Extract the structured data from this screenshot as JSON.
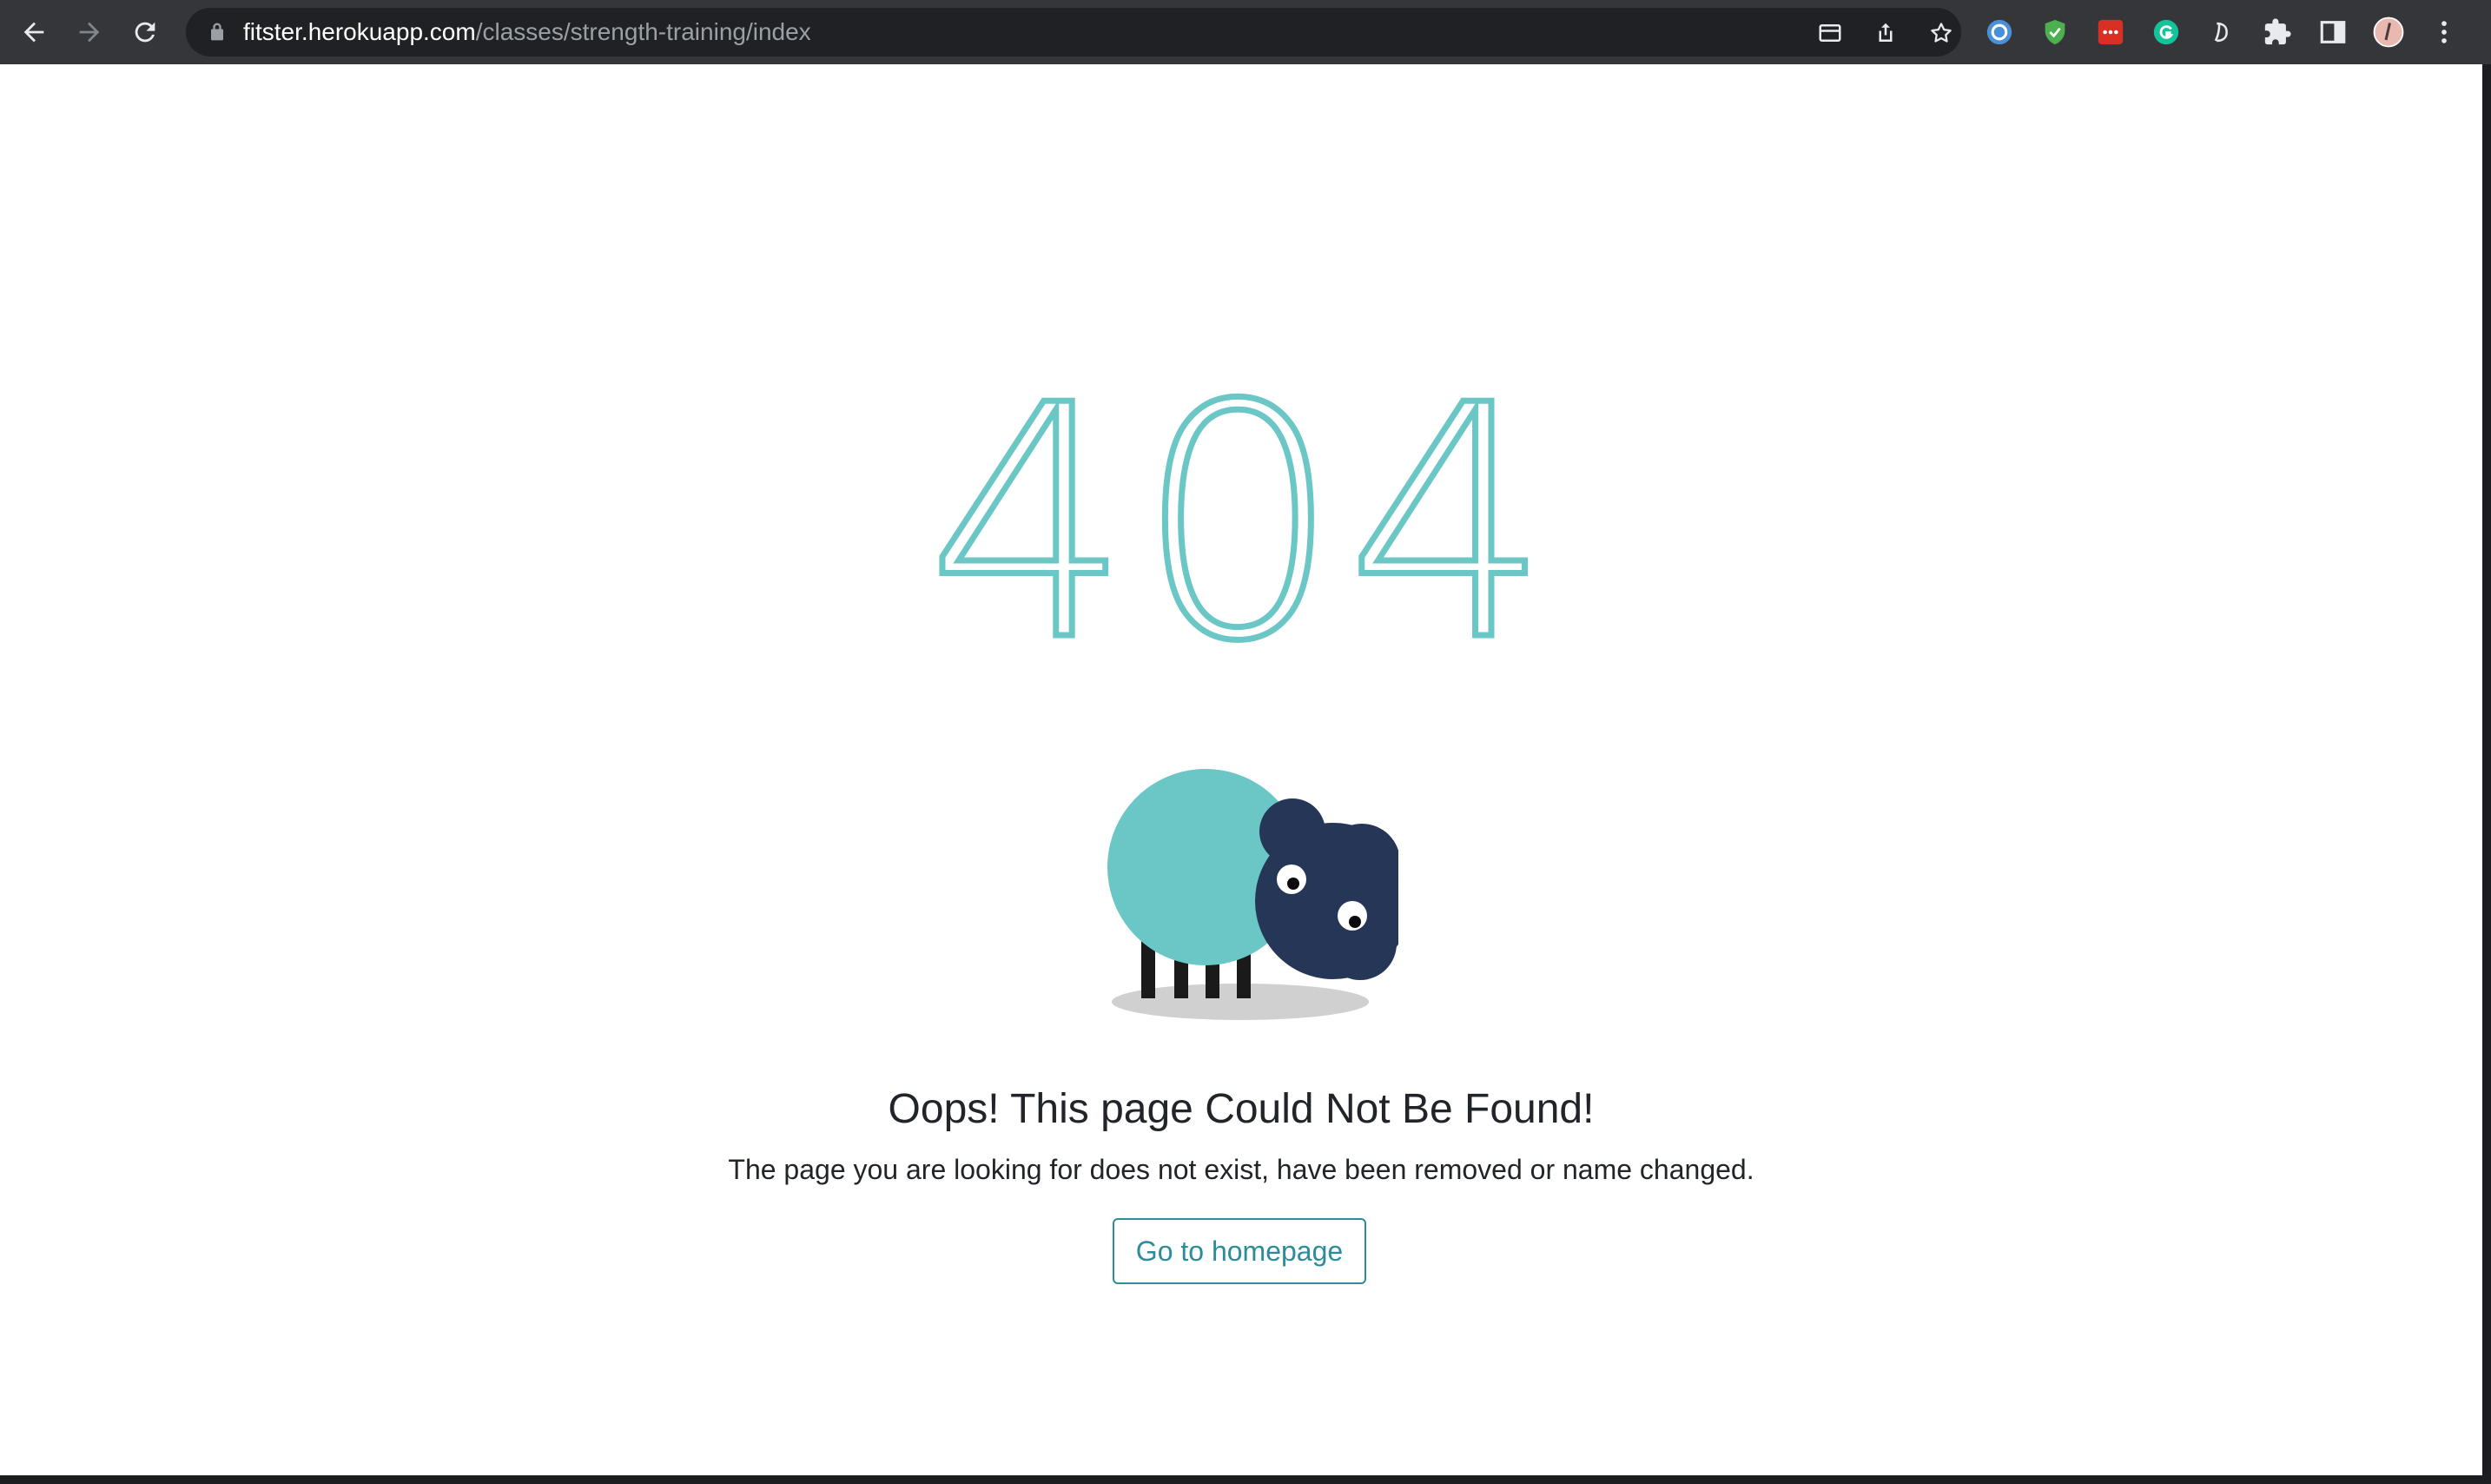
{
  "browser": {
    "url_host": "fitster.herokuapp.com",
    "url_path": "/classes/strength-training/index",
    "nav": {
      "back_icon": "arrow-left-icon",
      "forward_icon": "arrow-right-icon",
      "reload_icon": "reload-icon"
    },
    "extensions": [
      "password-manager-icon",
      "shield-check-icon",
      "red-dots-extension-icon",
      "grammarly-icon",
      "script-d-extension-icon",
      "puzzle-piece-icon",
      "side-panel-icon",
      "profile-avatar",
      "kebab-menu-icon"
    ]
  },
  "page": {
    "error_code": "404",
    "title": "Oops! This page Could Not Be Found!",
    "message": "The page you are looking for does not exist, have been removed or name changed.",
    "home_button": "Go to homepage"
  },
  "colors": {
    "accent": "#6ac7c6",
    "sheep_head": "#263656",
    "button": "#2c8c9a",
    "text": "#212529"
  }
}
